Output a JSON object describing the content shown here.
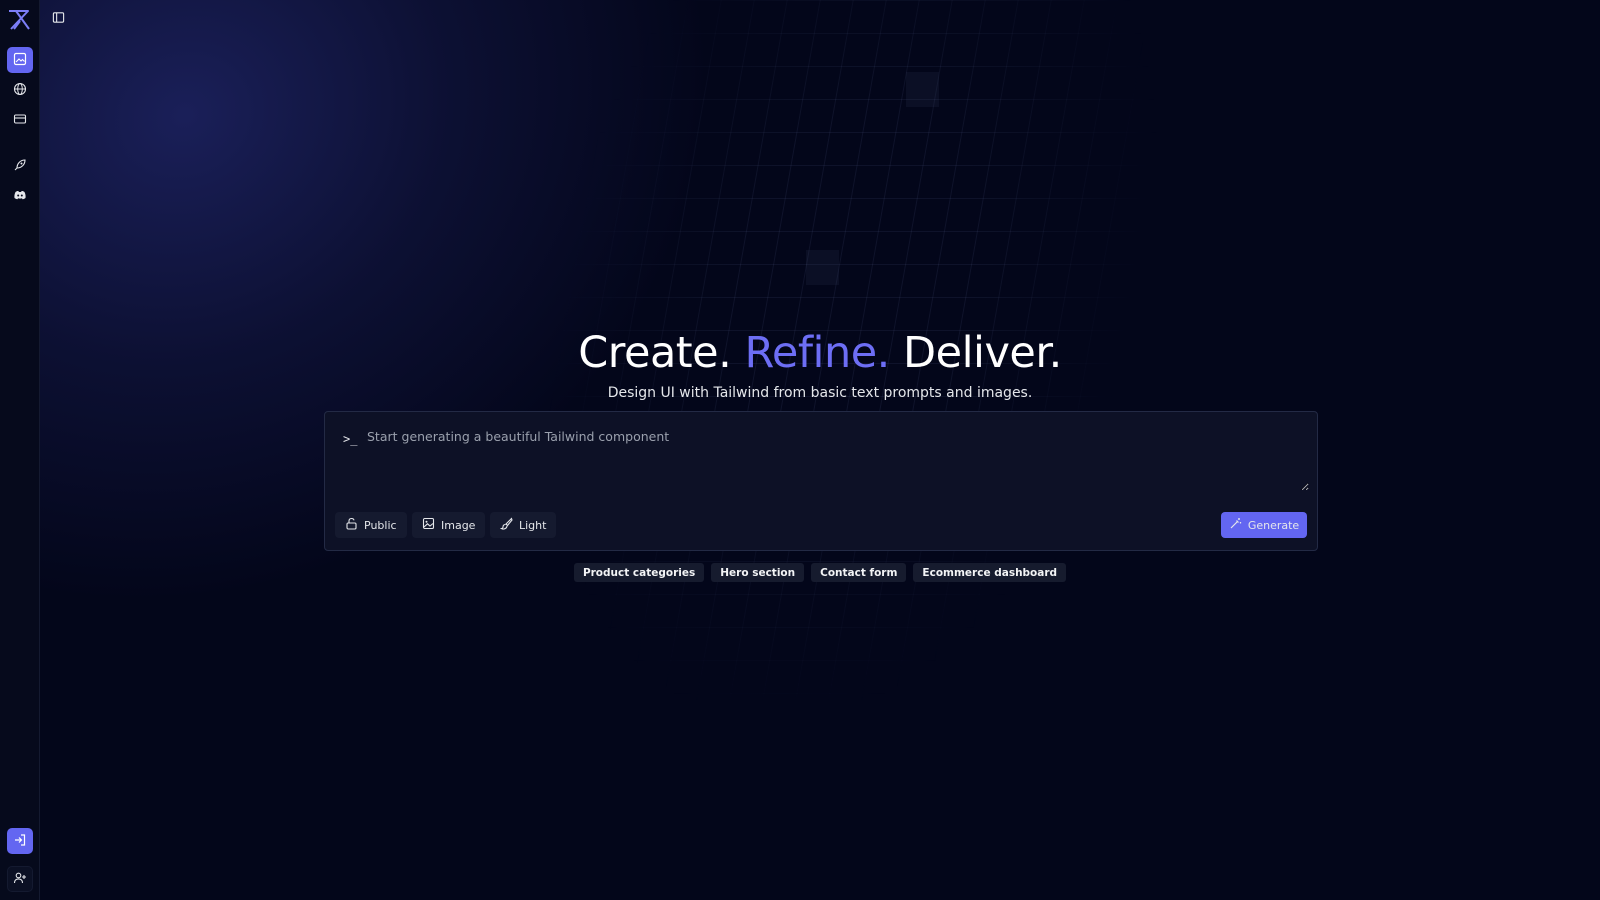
{
  "sidebar": {
    "items": [
      {
        "icon": "image-icon",
        "active": true
      },
      {
        "icon": "globe-icon",
        "active": false
      },
      {
        "icon": "credit-card-icon",
        "active": false
      },
      {
        "icon": "rocket-icon",
        "active": false
      },
      {
        "icon": "discord-icon",
        "active": false
      }
    ],
    "bottom": [
      {
        "icon": "sign-in-icon"
      },
      {
        "icon": "user-plus-icon"
      }
    ]
  },
  "hero": {
    "title_part1": "Create.",
    "title_part2": "Refine.",
    "title_part3": "Deliver.",
    "subtitle": "Design UI with Tailwind from basic text prompts and images."
  },
  "prompt": {
    "prefix": ">_",
    "placeholder": "Start generating a beautiful Tailwind component",
    "value": ""
  },
  "options": {
    "public_label": "Public",
    "image_label": "Image",
    "theme_label": "Light"
  },
  "generate_label": "Generate",
  "suggestions": [
    "Product categories",
    "Hero section",
    "Contact form",
    "Ecommerce dashboard"
  ],
  "colors": {
    "accent": "#6366f1",
    "background": "#03061a",
    "title_accent": "#6d6ef5"
  }
}
